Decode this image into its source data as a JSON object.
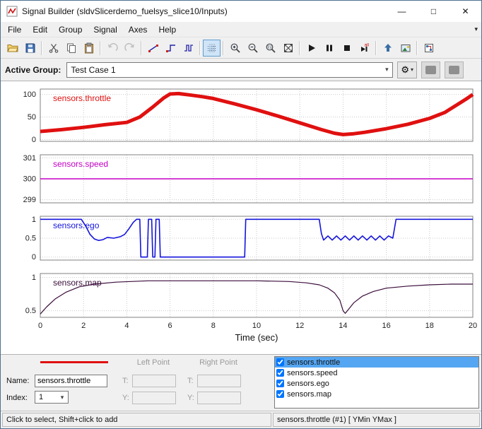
{
  "window": {
    "title": "Signal Builder (sldvSlicerdemo_fuelsys_slice10/Inputs)"
  },
  "titlebar": {
    "buttons": {
      "minimize": "—",
      "maximize": "□",
      "close": "✕"
    }
  },
  "menubar": {
    "items": [
      "File",
      "Edit",
      "Group",
      "Signal",
      "Axes",
      "Help"
    ],
    "overflow_icon": "▾"
  },
  "toolbar": {
    "groups": [
      [
        "open",
        "save"
      ],
      [
        "cut",
        "copy",
        "paste"
      ],
      [
        "undo",
        "redo"
      ],
      [
        "signal-line",
        "signal-step",
        "signal-pulse"
      ],
      [
        "grid"
      ],
      [
        "zoom-in",
        "zoom-out",
        "zoom-box",
        "fit-view"
      ],
      [
        "run",
        "pause",
        "stop",
        "step-all"
      ],
      [
        "up",
        "snapshot"
      ],
      [
        "model"
      ]
    ],
    "pressed": [
      "grid"
    ],
    "disabled": [
      "undo",
      "redo"
    ]
  },
  "active_group": {
    "label": "Active Group:",
    "value": "Test Case 1"
  },
  "x_axis": {
    "xlim": [
      0,
      20
    ],
    "ticks": [
      0,
      2,
      4,
      6,
      8,
      10,
      12,
      14,
      16,
      18,
      20
    ],
    "label": "Time (sec)"
  },
  "chart_data": [
    {
      "type": "line",
      "name": "sensors.throttle",
      "color": "#e01010",
      "line_width": 5,
      "ylim": [
        -4,
        112
      ],
      "yticks": [
        0,
        50,
        100
      ],
      "points": [
        [
          0,
          18
        ],
        [
          1,
          22
        ],
        [
          2,
          27
        ],
        [
          3,
          33
        ],
        [
          4,
          38
        ],
        [
          4.6,
          50
        ],
        [
          5.2,
          72
        ],
        [
          5.7,
          92
        ],
        [
          6,
          101
        ],
        [
          6.4,
          102
        ],
        [
          6.9,
          99
        ],
        [
          7.5,
          95
        ],
        [
          8,
          91
        ],
        [
          9,
          79
        ],
        [
          10,
          66
        ],
        [
          11,
          52
        ],
        [
          12,
          37
        ],
        [
          13,
          22
        ],
        [
          13.6,
          14
        ],
        [
          14,
          11
        ],
        [
          14.5,
          13
        ],
        [
          15,
          16
        ],
        [
          16,
          24
        ],
        [
          17,
          34
        ],
        [
          18,
          47
        ],
        [
          18.7,
          60
        ],
        [
          19.2,
          75
        ],
        [
          19.7,
          90
        ],
        [
          20,
          100
        ]
      ]
    },
    {
      "type": "line",
      "name": "sensors.speed",
      "color": "#c400c4",
      "line_width": 1.6,
      "ylim": [
        298.85,
        301.15
      ],
      "yticks": [
        299,
        300,
        301
      ],
      "points": [
        [
          0,
          300
        ],
        [
          20,
          300
        ]
      ]
    },
    {
      "type": "line",
      "name": "sensors.ego",
      "color": "#1414dd",
      "line_width": 1.6,
      "ylim": [
        -0.08,
        1.08
      ],
      "yticks": [
        0,
        0.5,
        1
      ],
      "points": [
        [
          0,
          1
        ],
        [
          1.9,
          1
        ],
        [
          2.1,
          0.82
        ],
        [
          2.3,
          0.6
        ],
        [
          2.5,
          0.48
        ],
        [
          2.7,
          0.44
        ],
        [
          2.9,
          0.46
        ],
        [
          3.1,
          0.52
        ],
        [
          3.4,
          0.5
        ],
        [
          3.7,
          0.54
        ],
        [
          3.9,
          0.6
        ],
        [
          4.1,
          0.75
        ],
        [
          4.3,
          0.92
        ],
        [
          4.45,
          1
        ],
        [
          4.6,
          1
        ],
        [
          4.65,
          0
        ],
        [
          4.95,
          0
        ],
        [
          5,
          1
        ],
        [
          5.15,
          1
        ],
        [
          5.2,
          0
        ],
        [
          5.3,
          0
        ],
        [
          5.35,
          1
        ],
        [
          5.5,
          1
        ],
        [
          5.55,
          0
        ],
        [
          9.45,
          0
        ],
        [
          9.5,
          1
        ],
        [
          12.9,
          1
        ],
        [
          13,
          0.62
        ],
        [
          13.1,
          0.45
        ],
        [
          13.3,
          0.56
        ],
        [
          13.5,
          0.45
        ],
        [
          13.7,
          0.56
        ],
        [
          13.9,
          0.45
        ],
        [
          14.1,
          0.56
        ],
        [
          14.3,
          0.45
        ],
        [
          14.5,
          0.56
        ],
        [
          14.7,
          0.45
        ],
        [
          14.9,
          0.56
        ],
        [
          15.1,
          0.45
        ],
        [
          15.3,
          0.56
        ],
        [
          15.5,
          0.45
        ],
        [
          15.7,
          0.56
        ],
        [
          15.9,
          0.45
        ],
        [
          16.1,
          0.56
        ],
        [
          16.3,
          0.5
        ],
        [
          16.45,
          1
        ],
        [
          20,
          1
        ]
      ]
    },
    {
      "type": "line",
      "name": "sensors.map",
      "color": "#3a0d3a",
      "line_width": 1.2,
      "ylim": [
        0.4,
        1.06
      ],
      "yticks": [
        0.5,
        1
      ],
      "points": [
        [
          0,
          0.45
        ],
        [
          0.3,
          0.56
        ],
        [
          0.7,
          0.68
        ],
        [
          1.2,
          0.78
        ],
        [
          1.8,
          0.86
        ],
        [
          2.5,
          0.9
        ],
        [
          3.5,
          0.93
        ],
        [
          5,
          0.95
        ],
        [
          8,
          0.95
        ],
        [
          10,
          0.95
        ],
        [
          11.5,
          0.94
        ],
        [
          12.3,
          0.92
        ],
        [
          12.9,
          0.89
        ],
        [
          13.3,
          0.84
        ],
        [
          13.6,
          0.77
        ],
        [
          13.85,
          0.66
        ],
        [
          14,
          0.5
        ],
        [
          14.1,
          0.46
        ],
        [
          14.25,
          0.52
        ],
        [
          14.5,
          0.62
        ],
        [
          14.9,
          0.72
        ],
        [
          15.4,
          0.79
        ],
        [
          16,
          0.84
        ],
        [
          17,
          0.87
        ],
        [
          18,
          0.89
        ],
        [
          19,
          0.9
        ],
        [
          20,
          0.9
        ]
      ]
    }
  ],
  "editor": {
    "left_point_label": "Left Point",
    "right_point_label": "Right Point",
    "name_label": "Name:",
    "name_value": "sensors.throttle",
    "index_label": "Index:",
    "index_value": "1",
    "t_label": "T:",
    "y_label": "Y:",
    "selected_color": "#e01010"
  },
  "signal_list": {
    "items": [
      {
        "label": "sensors.throttle",
        "checked": true,
        "selected": true
      },
      {
        "label": "sensors.speed",
        "checked": true,
        "selected": false
      },
      {
        "label": "sensors.ego",
        "checked": true,
        "selected": false
      },
      {
        "label": "sensors.map",
        "checked": true,
        "selected": false
      }
    ]
  },
  "statusbar": {
    "left": "Click to select, Shift+click to add",
    "right": "sensors.throttle (#1)  [ YMin YMax ]"
  }
}
